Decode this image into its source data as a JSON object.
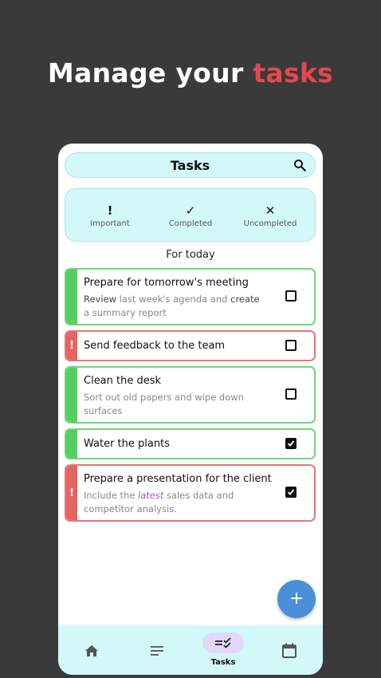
{
  "headline": {
    "prefix": "Manage your ",
    "accent": "tasks"
  },
  "topbar": {
    "title": "Tasks",
    "search_icon": "search-icon"
  },
  "filters": [
    {
      "symbol": "!",
      "label": "Important"
    },
    {
      "symbol": "✓",
      "label": "Completed"
    },
    {
      "symbol": "✕",
      "label": "Uncompleted"
    }
  ],
  "section_title": "For today",
  "tasks": [
    {
      "title": "Prepare for tomorrow's meeting",
      "desc": {
        "w1": "Review",
        "t1": " last week's agenda and ",
        "w2": "create",
        "t2": " a summary report"
      },
      "important": false,
      "completed": false
    },
    {
      "title": "Send feedback to the team",
      "important": true,
      "completed": false
    },
    {
      "title": "Clean the desk",
      "desc_text": "Sort out old papers and wipe down surfaces",
      "important": false,
      "completed": false
    },
    {
      "title": "Water the plants",
      "important": false,
      "completed": true
    },
    {
      "title": "Prepare a presentation for the client",
      "desc": {
        "t0": "Include the ",
        "w1": "latest",
        "t1": " sales data and competitor analysis."
      },
      "important": true,
      "completed": true
    }
  ],
  "fab": {
    "label": "+"
  },
  "nav": {
    "active_label": "Tasks",
    "items": [
      "home-icon",
      "notes-icon",
      "tasks-icon",
      "calendar-icon"
    ]
  },
  "colors": {
    "background": "#3a3a3a",
    "accent_red": "#e5484d",
    "green": "#55cf5f",
    "red": "#e46464",
    "cyan": "#d3f8f9",
    "fab": "#4a90d9"
  }
}
